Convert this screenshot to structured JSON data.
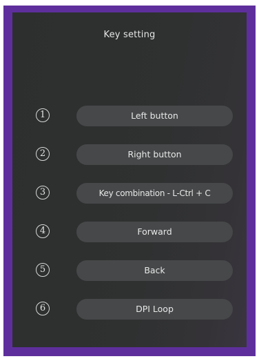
{
  "title": "Key setting",
  "keys": [
    {
      "number": "1",
      "label": "Left button"
    },
    {
      "number": "2",
      "label": "Right button"
    },
    {
      "number": "3",
      "label": "Key combination - L-Ctrl + C"
    },
    {
      "number": "4",
      "label": "Forward"
    },
    {
      "number": "5",
      "label": "Back"
    },
    {
      "number": "6",
      "label": "DPI Loop"
    }
  ],
  "colors": {
    "frame": "#5e2f9c",
    "panel": "#2f3131",
    "button": "#464849",
    "text": "#e8e8e8"
  }
}
